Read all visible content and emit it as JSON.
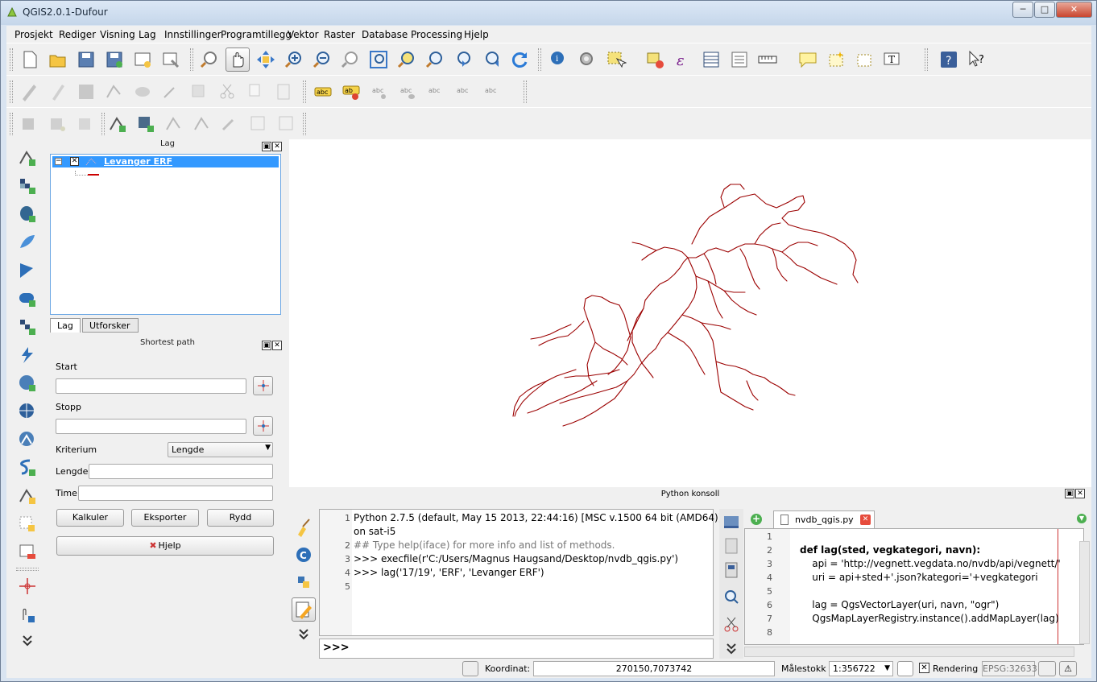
{
  "window": {
    "title": "QGIS2.0.1-Dufour",
    "min": "─",
    "max": "□",
    "close": "✕"
  },
  "menu": [
    "Prosjekt",
    "Rediger",
    "Visning",
    "Lag",
    "Innstillinger",
    "Programtillegg",
    "Vektor",
    "Raster",
    "Database",
    "Processing",
    "Hjelp"
  ],
  "layers_panel": {
    "title": "Lag",
    "layer_name": "Levanger ERF",
    "tabs": [
      "Lag",
      "Utforsker"
    ]
  },
  "shortest_path": {
    "title": "Shortest path",
    "start_label": "Start",
    "stop_label": "Stopp",
    "criterion_label": "Kriterium",
    "criterion_value": "Lengde",
    "length_label": "Lengde",
    "time_label": "Time",
    "calc_button": "Kalkuler",
    "export_button": "Eksporter",
    "clear_button": "Rydd",
    "help_button": "Hjelp"
  },
  "python": {
    "title": "Python konsoll",
    "console_lines": [
      {
        "n": "1",
        "t": "Python 2.7.5 (default, May 15 2013, 22:44:16) [MSC v.1500 64 bit (AMD64)]"
      },
      {
        "n": "",
        "t": "on sat-i5"
      },
      {
        "n": "2",
        "t": "## Type help(iface) for more info and list of methods."
      },
      {
        "n": "3",
        "t": ">>> execfile(r'C:/Users/Magnus Haugsand/Desktop/nvdb_qgis.py')"
      },
      {
        "n": "4",
        "t": ">>> lag('17/19', 'ERF', 'Levanger ERF')"
      },
      {
        "n": "5",
        "t": ""
      }
    ],
    "prompt": ">>>",
    "editor_tab": "nvdb_qgis.py",
    "editor_lines": [
      {
        "n": "1",
        "t": ""
      },
      {
        "n": "2",
        "t": "def lag(sted, vegkategori, navn):"
      },
      {
        "n": "3",
        "t": "    api = 'http://vegnett.vegdata.no/nvdb/api/vegnett/'"
      },
      {
        "n": "4",
        "t": "    uri = api+sted+'.json?kategori='+vegkategori"
      },
      {
        "n": "5",
        "t": ""
      },
      {
        "n": "6",
        "t": "    lag = QgsVectorLayer(uri, navn, \"ogr\")"
      },
      {
        "n": "7",
        "t": "    QgsMapLayerRegistry.instance().addMapLayer(lag)"
      },
      {
        "n": "8",
        "t": ""
      }
    ]
  },
  "status": {
    "coord_label": "Koordinat:",
    "coord_value": "270150,7073742",
    "scale_label": "Målestokk",
    "scale_value": "1:356722",
    "render_label": "Rendering",
    "crs": "EPSG:32633"
  },
  "colors": {
    "road": "#9b0000",
    "selection": "#3399ff"
  }
}
